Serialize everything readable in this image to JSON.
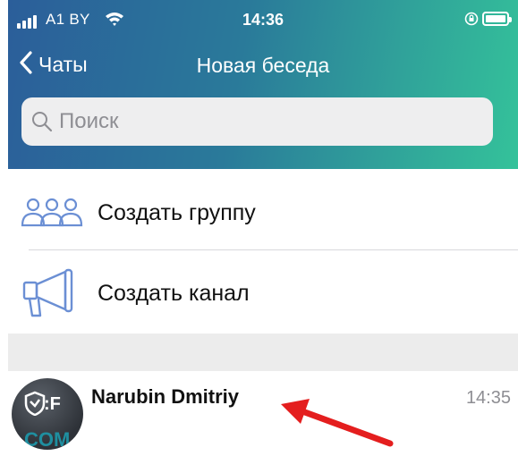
{
  "status_bar": {
    "carrier": "A1 BY",
    "time": "14:36"
  },
  "nav": {
    "back_label": "Чаты",
    "title": "Новая беседа"
  },
  "search": {
    "placeholder": "Поиск"
  },
  "menu": {
    "create_group": "Создать группу",
    "create_channel": "Создать канал"
  },
  "chats": [
    {
      "name": "Narubin Dmitriy",
      "time": "14:35",
      "avatar_text_top": ":F",
      "avatar_text_bottom": "COM"
    }
  ],
  "colors": {
    "accent_icon": "#6b8fd4",
    "annotation_arrow": "#e41e1e"
  }
}
